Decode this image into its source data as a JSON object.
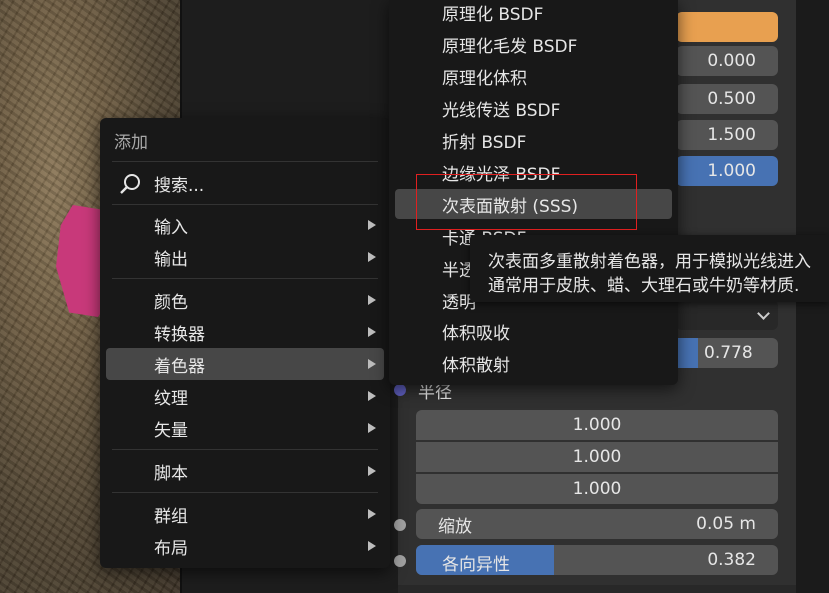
{
  "node_fields": [
    {
      "value": "0.000"
    },
    {
      "value": "0.500"
    },
    {
      "value": "1.500"
    },
    {
      "value": "1.000"
    },
    {
      "value": "0.778"
    }
  ],
  "radius_label": "半径",
  "radius_values": [
    "1.000",
    "1.000",
    "1.000"
  ],
  "scale": {
    "label": "缩放",
    "value": "0.05 m"
  },
  "anisotropy": {
    "label": "各向异性",
    "value": "0.382",
    "fill": 0.382
  },
  "add_menu": {
    "title": "添加",
    "search": "搜索...",
    "items": [
      {
        "label": "输入"
      },
      {
        "label": "输出"
      },
      {
        "label": "颜色"
      },
      {
        "label": "转换器"
      },
      {
        "label": "着色器"
      },
      {
        "label": "纹理"
      },
      {
        "label": "矢量"
      },
      {
        "label": "脚本"
      },
      {
        "label": "群组"
      },
      {
        "label": "布局"
      }
    ]
  },
  "shader_menu": {
    "items": [
      {
        "label": "原理化 BSDF"
      },
      {
        "label": "原理化毛发 BSDF"
      },
      {
        "label": "原理化体积"
      },
      {
        "label": "光线传送 BSDF"
      },
      {
        "label": "折射 BSDF"
      },
      {
        "label": "边缘光泽 BSDF"
      },
      {
        "label": "次表面散射 (SSS)"
      },
      {
        "label": "卡通 BSDF"
      },
      {
        "label": "半透"
      },
      {
        "label": "透明"
      },
      {
        "label": "体积吸收"
      },
      {
        "label": "体积散射"
      }
    ]
  },
  "tooltip": {
    "line1": "次表面多重散射着色器，用于模拟光线进入",
    "line2": "通常用于皮肤、蜡、大理石或牛奶等材质."
  },
  "colors": {
    "orange": "#e8a050",
    "blue": "#4772b3",
    "socket_purple": "#6363c7",
    "socket_gray": "#a1a1a1",
    "highlight_box": "#e02020"
  }
}
